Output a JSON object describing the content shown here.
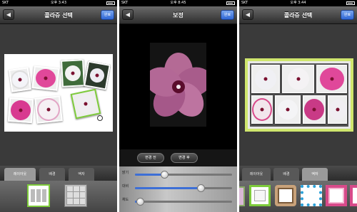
{
  "panels": [
    {
      "status": {
        "carrier": "SKT",
        "time": "오후 3:43"
      },
      "nav": {
        "back": "◀",
        "title": "콜라쥬 선택",
        "done": "완료"
      },
      "tabs": [
        "레이아웃",
        "배경",
        "액자"
      ],
      "active_tab": 0
    },
    {
      "status": {
        "carrier": "SKT",
        "time": "오후 8:45"
      },
      "nav": {
        "back": "◀",
        "title": "보정",
        "done": "완료"
      },
      "compare": {
        "before": "변경 전",
        "after": "변경 후"
      },
      "sliders": [
        {
          "label": "밝기",
          "value": 0.3
        },
        {
          "label": "대비",
          "value": 0.68
        },
        {
          "label": "채도",
          "value": 0.05
        }
      ]
    },
    {
      "status": {
        "carrier": "SKT",
        "time": "오후 3:44"
      },
      "nav": {
        "back": "◀",
        "title": "콜라쥬 선택",
        "done": "완료"
      },
      "tabs": [
        "레이아웃",
        "배경",
        "액자"
      ],
      "active_tab": 2
    }
  ],
  "colors": {
    "accent_blue": "#3d6fd6",
    "frame_green": "#cfe66d",
    "flower_pink": "#d94a8a"
  }
}
